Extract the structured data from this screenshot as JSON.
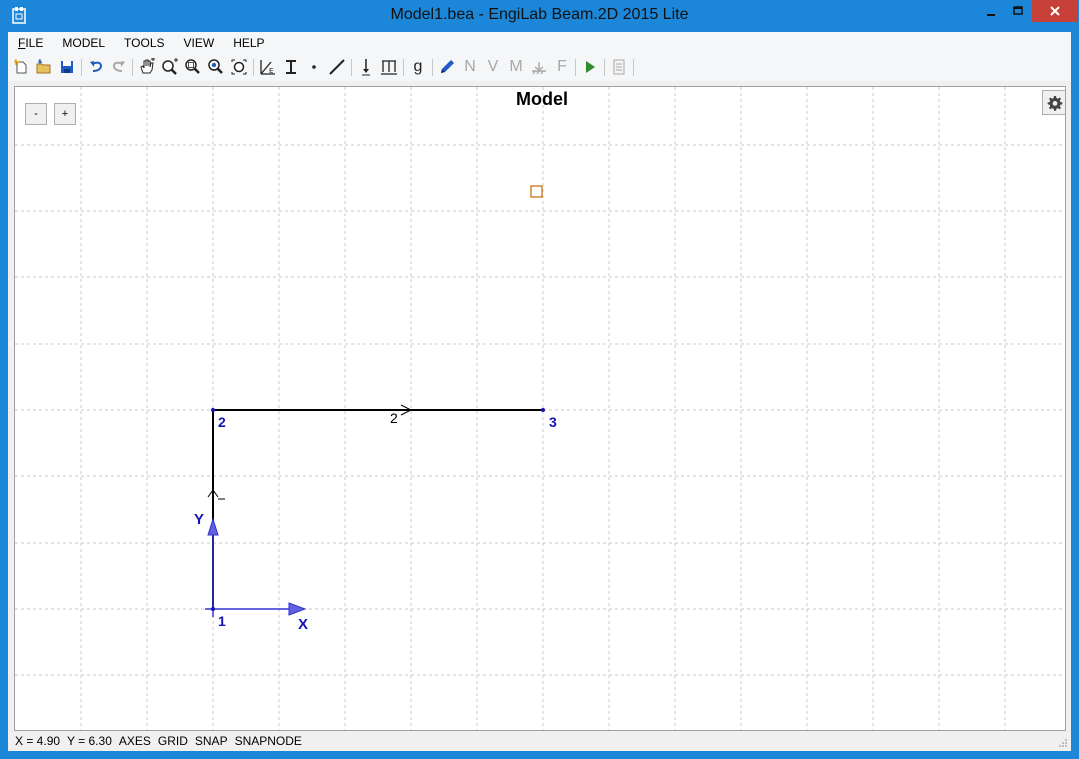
{
  "window": {
    "title": "Model1.bea - EngiLab Beam.2D 2015 Lite",
    "minimize_icon": "minimize-icon",
    "maximize_icon": "maximize-icon",
    "close_icon": "close-icon"
  },
  "menu": [
    {
      "label": "FILE",
      "mnemonic": "F",
      "rest": "ILE"
    },
    {
      "label": "MODEL"
    },
    {
      "label": "TOOLS"
    },
    {
      "label": "VIEW"
    },
    {
      "label": "HELP"
    }
  ],
  "toolbar": {
    "icons": [
      "new-file-icon",
      "open-file-icon",
      "save-icon",
      "undo-icon",
      "redo-icon",
      "pan-icon",
      "zoom-in-icon",
      "zoom-window-icon",
      "zoom-extents-icon",
      "zoom-previous-icon",
      "material-icon",
      "section-icon",
      "node-icon",
      "element-icon",
      "point-load-icon",
      "distributed-load-icon",
      "gravity-icon",
      "edit-icon",
      "axial-force-icon",
      "shear-force-icon",
      "moment-icon",
      "support-icon",
      "force-icon",
      "run-icon",
      "report-icon"
    ],
    "letters": {
      "gravity": "g",
      "axial": "N",
      "shear": "V",
      "moment": "M",
      "force": "F"
    },
    "colors": {
      "active": "#222222",
      "disabled": "#a8a8a8",
      "run": "#2d8c2d",
      "blue": "#1f5bc4"
    }
  },
  "canvas": {
    "title": "Model",
    "zoom_out_label": "-",
    "zoom_in_label": "+",
    "settings_icon": "gear-icon",
    "nodes": [
      {
        "label": "1"
      },
      {
        "label": "2"
      },
      {
        "label": "3"
      }
    ],
    "elements": [
      {
        "label": "2"
      }
    ],
    "axes": {
      "x_label": "X",
      "y_label": "Y"
    },
    "colors": {
      "node_label": "#1414b4",
      "axis": "#3232d2",
      "element": "#000000",
      "grid": "#c8c8c8",
      "marker": "#cc6600"
    }
  },
  "status": {
    "x_readout": "X = 4.90",
    "y_readout": "Y = 6.30",
    "flags": [
      "AXES",
      "GRID",
      "SNAP",
      "SNAPNODE"
    ]
  }
}
